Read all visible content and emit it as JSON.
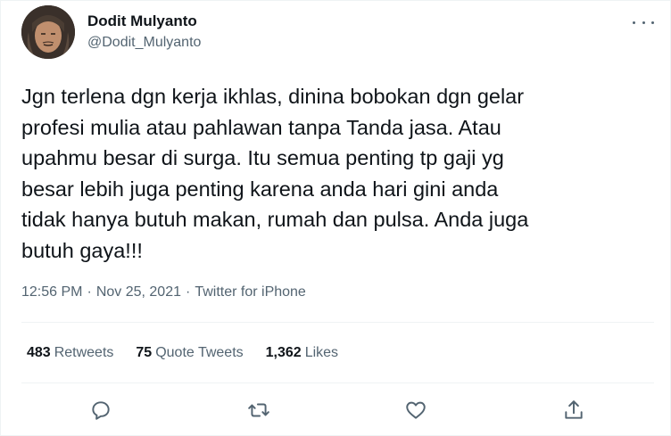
{
  "author": {
    "name": "Dodit Mulyanto",
    "handle": "@Dodit_Mulyanto"
  },
  "tweet": {
    "text": "Jgn terlena dgn kerja ikhlas, dinina bobokan dgn gelar\nprofesi mulia atau pahlawan tanpa Tanda jasa. Atau\nupahmu besar di surga. Itu semua penting tp gaji yg\nbesar lebih juga penting karena anda hari gini anda\ntidak hanya butuh makan, rumah dan pulsa. Anda juga\nbutuh gaya!!!",
    "time": "12:56 PM",
    "separator1": "·",
    "date": "Nov 25, 2021",
    "separator2": "·",
    "source": "Twitter for iPhone"
  },
  "stats": {
    "retweets_count": "483",
    "retweets_label": "Retweets",
    "quotes_count": "75",
    "quotes_label": "Quote Tweets",
    "likes_count": "1,362",
    "likes_label": "Likes"
  },
  "icons": {
    "reply": "reply-icon",
    "retweet": "retweet-icon",
    "like": "heart-icon",
    "share": "share-icon",
    "more": "more-icon"
  },
  "colors": {
    "text": "#0f1419",
    "secondary": "#536471",
    "divider": "#eff3f4"
  }
}
